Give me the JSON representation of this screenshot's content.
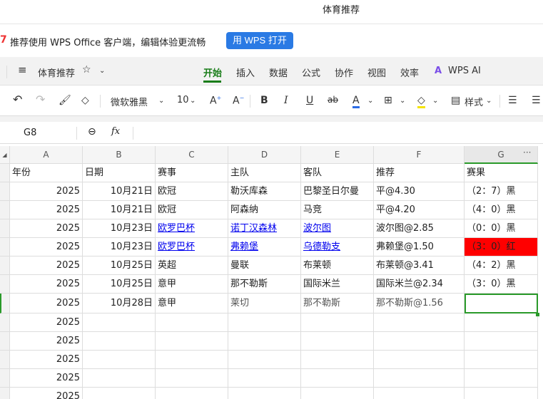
{
  "window_title": "体育推荐",
  "banner": {
    "text": "推荐使用 WPS Office 客户端，编辑体验更流畅",
    "button": "用 WPS 打开"
  },
  "toolbar": {
    "menu_icon": "≡",
    "doc_name": "体育推荐",
    "tabs": [
      "开始",
      "插入",
      "数据",
      "公式",
      "协作",
      "视图",
      "效率",
      "WPS AI"
    ],
    "active_tab": "开始"
  },
  "format": {
    "font": "微软雅黑",
    "size": "10",
    "style_label": "样式",
    "font_color": "#2a6ae4",
    "fill_color": "#f5e400"
  },
  "formula_bar": {
    "cell_ref": "G8",
    "fx": "fx",
    "value": ""
  },
  "columns": [
    "A",
    "B",
    "C",
    "D",
    "E",
    "F",
    "G"
  ],
  "selected_cell": "G8",
  "header_row": [
    "年份",
    "日期",
    "赛事",
    "主队",
    "客队",
    "推荐",
    "赛果"
  ],
  "rows": [
    [
      "2025",
      "10月21日",
      "欧冠",
      "勒沃库森",
      "巴黎圣日尔曼",
      "平@4.30",
      "（2：7）黑"
    ],
    [
      "2025",
      "10月21日",
      "欧冠",
      "阿森纳",
      "马竞",
      "平@4.20",
      "（4：0）黑"
    ],
    [
      "2025",
      "10月23日",
      "欧罗巴杯",
      "诺丁汉森林",
      "波尔图",
      "波尔图@2.85",
      "（0：0）黑"
    ],
    [
      "2025",
      "10月23日",
      "欧罗巴杯",
      "弗赖堡",
      "乌德勒支",
      "弗赖堡@1.50",
      "（3：0）红"
    ],
    [
      "2025",
      "10月25日",
      "英超",
      "曼联",
      "布莱顿",
      "布莱顿@3.41",
      "（4：2）黑"
    ],
    [
      "2025",
      "10月25日",
      "意甲",
      "那不勒斯",
      "国际米兰",
      "国际米兰@2.34",
      "（3：0）黑"
    ],
    [
      "2025",
      "10月28日",
      "意甲",
      "莱切",
      "那不勒斯",
      "那不勒斯@1.56",
      ""
    ],
    [
      "2025",
      "",
      "",
      "",
      "",
      "",
      ""
    ],
    [
      "2025",
      "",
      "",
      "",
      "",
      "",
      ""
    ],
    [
      "2025",
      "",
      "",
      "",
      "",
      "",
      ""
    ],
    [
      "2025",
      "",
      "",
      "",
      "",
      "",
      ""
    ],
    [
      "2025",
      "",
      "",
      "",
      "",
      "",
      ""
    ]
  ],
  "link_cells": [
    [
      2,
      2
    ],
    [
      2,
      3
    ],
    [
      2,
      4
    ],
    [
      3,
      2
    ],
    [
      3,
      3
    ],
    [
      3,
      4
    ]
  ],
  "highlight": {
    "row": 3,
    "col": 6,
    "color": "#ff0000"
  }
}
